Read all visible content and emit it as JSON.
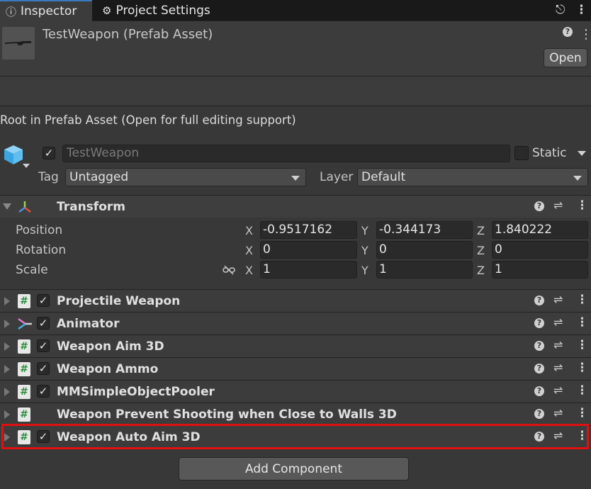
{
  "tabs": [
    {
      "label": "Inspector",
      "icon": "info-icon",
      "active": true
    },
    {
      "label": "Project Settings",
      "icon": "gear-icon",
      "active": false
    }
  ],
  "header": {
    "title": "TestWeapon (Prefab Asset)",
    "open_label": "Open"
  },
  "root_note": "Root in Prefab Asset (Open for full editing support)",
  "gameobject": {
    "name": "TestWeapon",
    "active": true,
    "static_label": "Static",
    "tag_label": "Tag",
    "tag_value": "Untagged",
    "layer_label": "Layer",
    "layer_value": "Default"
  },
  "transform": {
    "title": "Transform",
    "position": {
      "label": "Position",
      "x": "-0.9517162",
      "y": "-0.344173",
      "z": "1.840222"
    },
    "rotation": {
      "label": "Rotation",
      "x": "0",
      "y": "0",
      "z": "0"
    },
    "scale": {
      "label": "Scale",
      "x": "1",
      "y": "1",
      "z": "1"
    },
    "axis_labels": {
      "x": "X",
      "y": "Y",
      "z": "Z"
    }
  },
  "components": [
    {
      "name": "Projectile Weapon",
      "icon": "script-icon",
      "enabled": true
    },
    {
      "name": "Animator",
      "icon": "animator-icon",
      "enabled": true
    },
    {
      "name": "Weapon Aim 3D",
      "icon": "script-icon",
      "enabled": true
    },
    {
      "name": "Weapon Ammo",
      "icon": "script-icon",
      "enabled": true
    },
    {
      "name": "MMSimpleObjectPooler",
      "icon": "script-icon",
      "enabled": true
    },
    {
      "name": "Weapon Prevent Shooting when Close to Walls 3D",
      "icon": "script-icon",
      "enabled": null
    },
    {
      "name": "Weapon Auto Aim 3D",
      "icon": "script-icon",
      "enabled": true,
      "highlighted": true
    }
  ],
  "add_component_label": "Add Component",
  "colors": {
    "highlight": "#e01010",
    "tab_accent": "#3a79bb"
  }
}
